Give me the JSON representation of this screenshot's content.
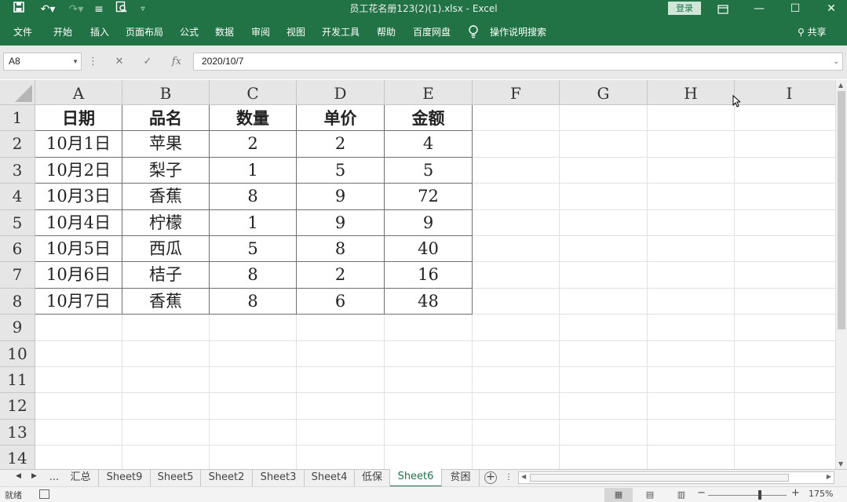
{
  "app": {
    "title": "员工花名册123(2)(1).xlsx  -  Excel",
    "login": "登录",
    "share": "共享"
  },
  "menu": [
    "文件",
    "开始",
    "插入",
    "页面布局",
    "公式",
    "数据",
    "审阅",
    "视图",
    "开发工具",
    "帮助",
    "百度网盘",
    "操作说明搜索"
  ],
  "formula": {
    "name_box": "A8",
    "value": "2020/10/7"
  },
  "columns": [
    "A",
    "B",
    "C",
    "D",
    "E",
    "F",
    "G",
    "H",
    "I"
  ],
  "rows": [
    "1",
    "2",
    "3",
    "4",
    "5",
    "6",
    "7",
    "8",
    "9",
    "10",
    "11",
    "12",
    "13",
    "14"
  ],
  "table": {
    "header": [
      "日期",
      "品名",
      "数量",
      "单价",
      "金额"
    ],
    "data": [
      [
        "10月1日",
        "苹果",
        "2",
        "2",
        "4"
      ],
      [
        "10月2日",
        "梨子",
        "1",
        "5",
        "5"
      ],
      [
        "10月3日",
        "香蕉",
        "8",
        "9",
        "72"
      ],
      [
        "10月4日",
        "柠檬",
        "1",
        "9",
        "9"
      ],
      [
        "10月5日",
        "西瓜",
        "5",
        "8",
        "40"
      ],
      [
        "10月6日",
        "桔子",
        "8",
        "2",
        "16"
      ],
      [
        "10月7日",
        "香蕉",
        "8",
        "6",
        "48"
      ]
    ]
  },
  "sheets": {
    "ellipsis": "...",
    "tabs": [
      "汇总",
      "Sheet9",
      "Sheet5",
      "Sheet2",
      "Sheet3",
      "Sheet4",
      "低保",
      "Sheet6",
      "贫困"
    ],
    "active": "Sheet6"
  },
  "status": {
    "ready": "就绪",
    "zoom": "175%"
  },
  "colors": {
    "accent": "#217346"
  }
}
